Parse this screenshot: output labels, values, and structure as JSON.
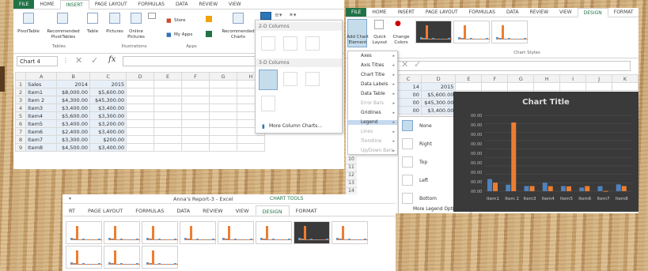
{
  "win1": {
    "tabs": [
      "FILE",
      "HOME",
      "INSERT",
      "PAGE LAYOUT",
      "FORMULAS",
      "DATA",
      "REVIEW",
      "VIEW"
    ],
    "active_tab": "INSERT",
    "buttons": {
      "pivot_table": "PivotTable",
      "recommended_pivot": "Recommended\nPivotTables",
      "table": "Table",
      "pictures": "Pictures",
      "online_pictures": "Online\nPictures",
      "store": "Store",
      "my_apps": "My Apps",
      "recommended_charts": "Recommended\nCharts"
    },
    "groups": {
      "tables": "Tables",
      "illustrations": "Illustrations",
      "apps": "Apps"
    },
    "name_box": "Chart 4",
    "fx": "fx",
    "columns": [
      "A",
      "B",
      "C",
      "D",
      "E",
      "F",
      "G",
      "H"
    ],
    "rows": [
      [
        "Sales",
        "2014",
        "2015"
      ],
      [
        "Item1",
        "$8,000.00",
        "$5,600.00"
      ],
      [
        "Item 2",
        "$4,300.00",
        "$45,300.00"
      ],
      [
        "Item3",
        "$3,400.00",
        "$3,400.00"
      ],
      [
        "Item4",
        "$5,600.00",
        "$3,300.00"
      ],
      [
        "Item5",
        "$3,400.00",
        "$3,200.00"
      ],
      [
        "Item6",
        "$2,400.00",
        "$3,400.00"
      ],
      [
        "Item7",
        "$3,300.00",
        "$200.00"
      ],
      [
        "Item8",
        "$4,500.00",
        "$3,400.00"
      ]
    ],
    "row_numbers": [
      "1",
      "2",
      "3",
      "4",
      "5",
      "6",
      "7",
      "8",
      "9"
    ],
    "dropdown": {
      "section_2d": "2-D Columns",
      "section_3d": "3-D Columns",
      "more": "More Column Charts..."
    }
  },
  "win2": {
    "tabs": [
      "FILE",
      "HOME",
      "INSERT",
      "PAGE LAYOUT",
      "FORMULAS",
      "DATA",
      "REVIEW",
      "VIEW",
      "DESIGN",
      "FORMAT"
    ],
    "active_tab": "DESIGN",
    "buttons": {
      "add_chart_element": "Add Chart\nElement",
      "quick_layout": "Quick\nLayout",
      "change_colors": "Change\nColors"
    },
    "chart_styles_label": "Chart Styles",
    "columns": [
      "C",
      "D",
      "E",
      "F",
      "G",
      "H",
      "I",
      "J",
      "K"
    ],
    "partial_rows": [
      [
        "14",
        "2015"
      ],
      [
        "00",
        "$5,600.00"
      ],
      [
        "00",
        "$45,300.00"
      ],
      [
        "00",
        "$3,400.00"
      ]
    ],
    "row_numbers": [
      "10",
      "11",
      "12",
      "13",
      "14"
    ],
    "element_menu": [
      "Axes",
      "Axis Titles",
      "Chart Title",
      "Data Labels",
      "Data Table",
      "Error Bars",
      "Gridlines",
      "Legend",
      "Lines",
      "Trendline",
      "Up/Down Bars"
    ],
    "legend_submenu": [
      "None",
      "Right",
      "Top",
      "Left",
      "Bottom"
    ],
    "legend_more": "More Legend Options...",
    "chart_axis_ticks": [
      "00.00",
      "00.00",
      "00.00",
      "00.00",
      "00.00",
      "00.00",
      "00.00",
      "00.00",
      "00.00"
    ]
  },
  "win3": {
    "title": "Anna's Report-3 - Excel",
    "tools_label": "CHART TOOLS",
    "tabs": [
      "RT",
      "PAGE LAYOUT",
      "FORMULAS",
      "DATA",
      "REVIEW",
      "VIEW",
      "DESIGN",
      "FORMAT"
    ],
    "active_tab": "DESIGN"
  },
  "chart_data": {
    "type": "bar",
    "title": "Chart Title",
    "categories": [
      "Item1",
      "Item 2",
      "Item3",
      "Item4",
      "Item5",
      "Item6",
      "Item7",
      "Item8"
    ],
    "series": [
      {
        "name": "2014",
        "values": [
          8000,
          4300,
          3400,
          5600,
          3400,
          2400,
          3300,
          4500
        ]
      },
      {
        "name": "2015",
        "values": [
          5600,
          45300,
          3400,
          3300,
          3200,
          3400,
          200,
          3400
        ]
      }
    ],
    "colors": {
      "2014": "#4f81bd",
      "2015": "#ed7d31"
    },
    "background": "#3a3a3a"
  }
}
